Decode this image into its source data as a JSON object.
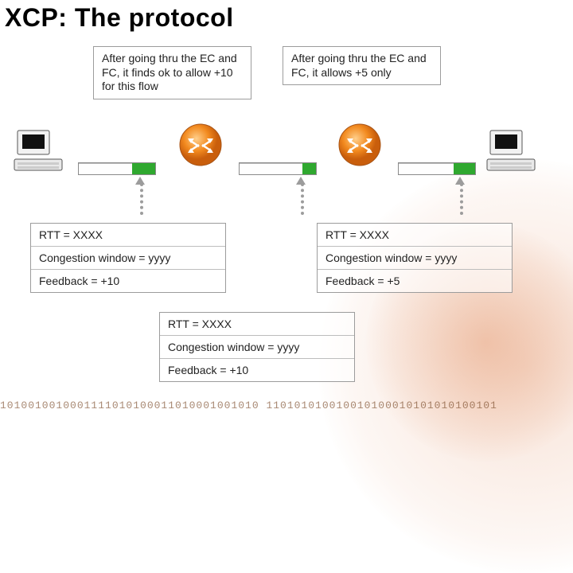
{
  "title": "XCP: The protocol",
  "callouts": {
    "left": "After going thru the EC and FC, it finds ok to allow +10 for this flow",
    "right": "After going thru the EC and FC, it allows +5 only"
  },
  "infoboxes": {
    "left": {
      "rtt": "RTT = XXXX",
      "cwnd": "Congestion window = yyyy",
      "fb": "Feedback = +10"
    },
    "right": {
      "rtt": "RTT = XXXX",
      "cwnd": "Congestion window = yyyy",
      "fb": "Feedback = +5"
    },
    "bottom": {
      "rtt": "RTT = XXXX",
      "cwnd": "Congestion window = yyyy",
      "fb": "Feedback = +10"
    }
  },
  "bars": {
    "left_pct": 70,
    "mid_pct": 82,
    "right_pct": 72
  },
  "binary": "1010010010001111010100011010001001010  110101010010010100010101010100101"
}
